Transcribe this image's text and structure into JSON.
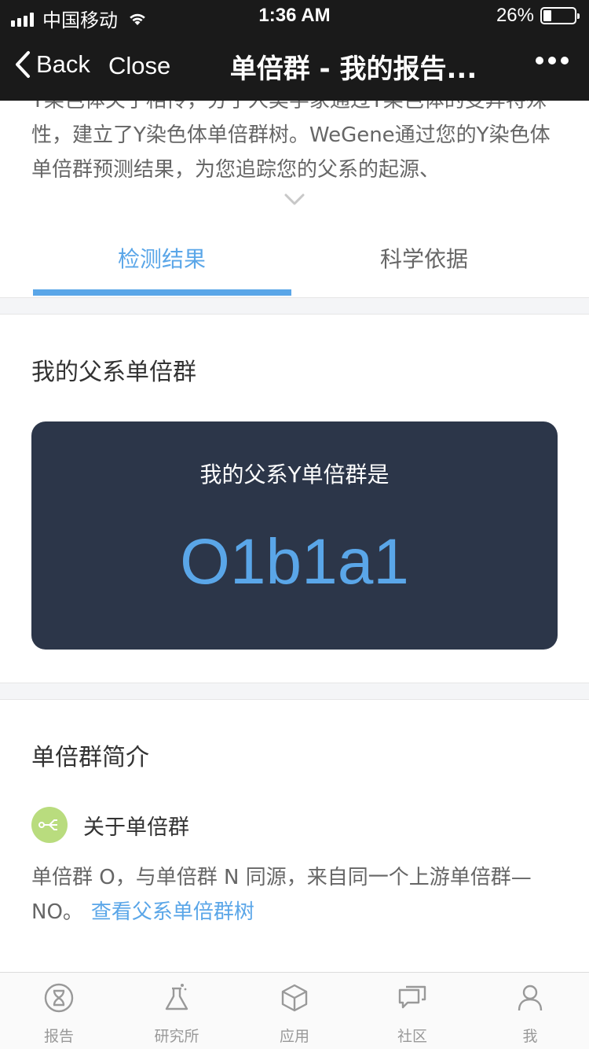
{
  "status_bar": {
    "carrier": "中国移动",
    "time": "1:36 AM",
    "battery": "26%",
    "battery_level": 0.26
  },
  "nav": {
    "back_label": "Back",
    "close_label": "Close",
    "title": "单倍群 - 我的报告..."
  },
  "intro": {
    "text": "Y染色体关于相传，分子人类学家通过Y染色体的变异特殊性，建立了Y染色体单倍群树。WeGene通过您的Y染色体单倍群预测结果，为您追踪您的父系的起源、"
  },
  "tabs": {
    "active": "检测结果",
    "inactive": "科学依据"
  },
  "result": {
    "section_title": "我的父系单倍群",
    "card_label": "我的父系Y单倍群是",
    "haplogroup": "O1b1a1"
  },
  "intro_section": {
    "section_title": "单倍群简介",
    "subtitle": "关于单倍群",
    "body": "单倍群 O，与单倍群 N 同源，来自同一个上游单倍群—NO。",
    "link": "查看父系单倍群树"
  },
  "tabbar": {
    "items": [
      {
        "label": "报告",
        "icon": "dna-report-icon"
      },
      {
        "label": "研究所",
        "icon": "flask-icon"
      },
      {
        "label": "应用",
        "icon": "cube-icon"
      },
      {
        "label": "社区",
        "icon": "chat-bubbles-icon"
      },
      {
        "label": "我",
        "icon": "person-icon"
      }
    ]
  }
}
